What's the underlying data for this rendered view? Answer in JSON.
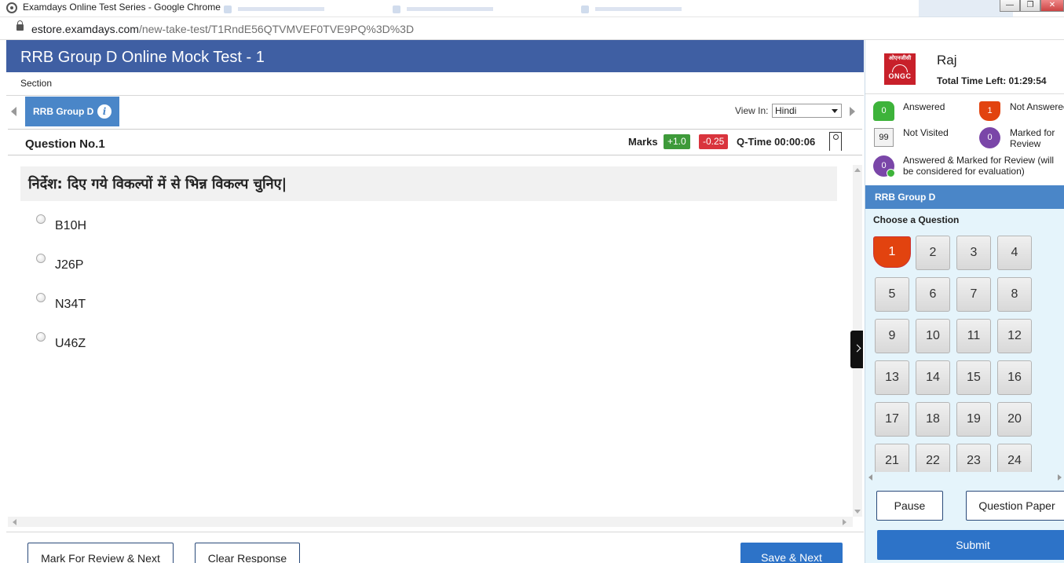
{
  "browser": {
    "window_title": "Examdays Online Test Series - Google Chrome",
    "url_host": "estore.examdays.com",
    "url_path": "/new-take-test/T1RndE56QTVMVEF0TVE9PQ%3D%3D"
  },
  "header": {
    "title": "RRB Group D Online Mock Test - 1"
  },
  "section": {
    "label": "Section",
    "active_tab": "RRB Group D",
    "info_glyph": "i",
    "view_in_label": "View In:",
    "language": "Hindi"
  },
  "question": {
    "number_label": "Question No.1",
    "marks_label": "Marks",
    "positive": "+1.0",
    "negative": "-0.25",
    "time_label": "Q-Time 00:00:06",
    "direction": "निर्देश: दिए गये विकल्पों में से भिन्न विकल्प चुनिए|",
    "options": [
      "B10H",
      "J26P",
      "N34T",
      "U46Z"
    ]
  },
  "actions": {
    "mark_review": "Mark For Review & Next",
    "clear": "Clear Response",
    "save_next": "Save & Next"
  },
  "profile": {
    "logo_top": "ओएनजीसी",
    "logo_bottom": "ONGC",
    "name": "Raj",
    "time_left": "Total Time Left: 01:29:54"
  },
  "legend": {
    "answered": {
      "count": "0",
      "label": "Answered"
    },
    "not_answered": {
      "count": "1",
      "label": "Not Answered"
    },
    "not_visited": {
      "count": "99",
      "label": "Not Visited"
    },
    "marked": {
      "count": "0",
      "label": "Marked for Review"
    },
    "answered_marked": {
      "count": "0",
      "label": "Answered & Marked for Review (will be considered for evaluation)"
    }
  },
  "palette": {
    "section": "RRB Group D",
    "choose": "Choose a Question",
    "current": "1",
    "questions": [
      "1",
      "2",
      "3",
      "4",
      "5",
      "6",
      "7",
      "8",
      "9",
      "10",
      "11",
      "12",
      "13",
      "14",
      "15",
      "16",
      "17",
      "18",
      "19",
      "20",
      "21",
      "22",
      "23",
      "24"
    ]
  },
  "panel_buttons": {
    "pause": "Pause",
    "question_paper": "Question Paper",
    "submit": "Submit"
  },
  "colors": {
    "header_blue": "#3f5fa3",
    "tab_blue": "#4a86c8",
    "answered_green": "#3db33a",
    "not_answered_orange": "#e2430f",
    "marked_purple": "#7a46a8",
    "panel_bg": "#e5f4fb"
  }
}
